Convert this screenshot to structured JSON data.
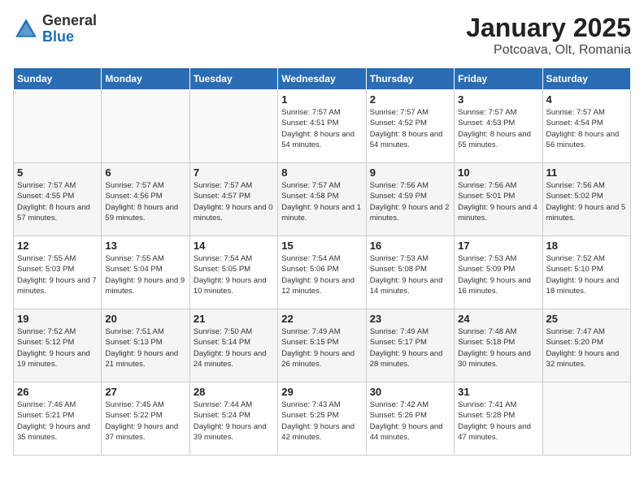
{
  "header": {
    "logo_general": "General",
    "logo_blue": "Blue",
    "month": "January 2025",
    "location": "Potcoava, Olt, Romania"
  },
  "weekdays": [
    "Sunday",
    "Monday",
    "Tuesday",
    "Wednesday",
    "Thursday",
    "Friday",
    "Saturday"
  ],
  "weeks": [
    [
      {
        "day": null
      },
      {
        "day": null
      },
      {
        "day": null
      },
      {
        "day": "1",
        "sunrise": "7:57 AM",
        "sunset": "4:51 PM",
        "daylight": "8 hours and 54 minutes."
      },
      {
        "day": "2",
        "sunrise": "7:57 AM",
        "sunset": "4:52 PM",
        "daylight": "8 hours and 54 minutes."
      },
      {
        "day": "3",
        "sunrise": "7:57 AM",
        "sunset": "4:53 PM",
        "daylight": "8 hours and 55 minutes."
      },
      {
        "day": "4",
        "sunrise": "7:57 AM",
        "sunset": "4:54 PM",
        "daylight": "8 hours and 56 minutes."
      }
    ],
    [
      {
        "day": "5",
        "sunrise": "7:57 AM",
        "sunset": "4:55 PM",
        "daylight": "8 hours and 57 minutes."
      },
      {
        "day": "6",
        "sunrise": "7:57 AM",
        "sunset": "4:56 PM",
        "daylight": "8 hours and 59 minutes."
      },
      {
        "day": "7",
        "sunrise": "7:57 AM",
        "sunset": "4:57 PM",
        "daylight": "9 hours and 0 minutes."
      },
      {
        "day": "8",
        "sunrise": "7:57 AM",
        "sunset": "4:58 PM",
        "daylight": "9 hours and 1 minute."
      },
      {
        "day": "9",
        "sunrise": "7:56 AM",
        "sunset": "4:59 PM",
        "daylight": "9 hours and 2 minutes."
      },
      {
        "day": "10",
        "sunrise": "7:56 AM",
        "sunset": "5:01 PM",
        "daylight": "9 hours and 4 minutes."
      },
      {
        "day": "11",
        "sunrise": "7:56 AM",
        "sunset": "5:02 PM",
        "daylight": "9 hours and 5 minutes."
      }
    ],
    [
      {
        "day": "12",
        "sunrise": "7:55 AM",
        "sunset": "5:03 PM",
        "daylight": "9 hours and 7 minutes."
      },
      {
        "day": "13",
        "sunrise": "7:55 AM",
        "sunset": "5:04 PM",
        "daylight": "9 hours and 9 minutes."
      },
      {
        "day": "14",
        "sunrise": "7:54 AM",
        "sunset": "5:05 PM",
        "daylight": "9 hours and 10 minutes."
      },
      {
        "day": "15",
        "sunrise": "7:54 AM",
        "sunset": "5:06 PM",
        "daylight": "9 hours and 12 minutes."
      },
      {
        "day": "16",
        "sunrise": "7:53 AM",
        "sunset": "5:08 PM",
        "daylight": "9 hours and 14 minutes."
      },
      {
        "day": "17",
        "sunrise": "7:53 AM",
        "sunset": "5:09 PM",
        "daylight": "9 hours and 16 minutes."
      },
      {
        "day": "18",
        "sunrise": "7:52 AM",
        "sunset": "5:10 PM",
        "daylight": "9 hours and 18 minutes."
      }
    ],
    [
      {
        "day": "19",
        "sunrise": "7:52 AM",
        "sunset": "5:12 PM",
        "daylight": "9 hours and 19 minutes."
      },
      {
        "day": "20",
        "sunrise": "7:51 AM",
        "sunset": "5:13 PM",
        "daylight": "9 hours and 21 minutes."
      },
      {
        "day": "21",
        "sunrise": "7:50 AM",
        "sunset": "5:14 PM",
        "daylight": "9 hours and 24 minutes."
      },
      {
        "day": "22",
        "sunrise": "7:49 AM",
        "sunset": "5:15 PM",
        "daylight": "9 hours and 26 minutes."
      },
      {
        "day": "23",
        "sunrise": "7:49 AM",
        "sunset": "5:17 PM",
        "daylight": "9 hours and 28 minutes."
      },
      {
        "day": "24",
        "sunrise": "7:48 AM",
        "sunset": "5:18 PM",
        "daylight": "9 hours and 30 minutes."
      },
      {
        "day": "25",
        "sunrise": "7:47 AM",
        "sunset": "5:20 PM",
        "daylight": "9 hours and 32 minutes."
      }
    ],
    [
      {
        "day": "26",
        "sunrise": "7:46 AM",
        "sunset": "5:21 PM",
        "daylight": "9 hours and 35 minutes."
      },
      {
        "day": "27",
        "sunrise": "7:45 AM",
        "sunset": "5:22 PM",
        "daylight": "9 hours and 37 minutes."
      },
      {
        "day": "28",
        "sunrise": "7:44 AM",
        "sunset": "5:24 PM",
        "daylight": "9 hours and 39 minutes."
      },
      {
        "day": "29",
        "sunrise": "7:43 AM",
        "sunset": "5:25 PM",
        "daylight": "9 hours and 42 minutes."
      },
      {
        "day": "30",
        "sunrise": "7:42 AM",
        "sunset": "5:26 PM",
        "daylight": "9 hours and 44 minutes."
      },
      {
        "day": "31",
        "sunrise": "7:41 AM",
        "sunset": "5:28 PM",
        "daylight": "9 hours and 47 minutes."
      },
      {
        "day": null
      }
    ]
  ]
}
